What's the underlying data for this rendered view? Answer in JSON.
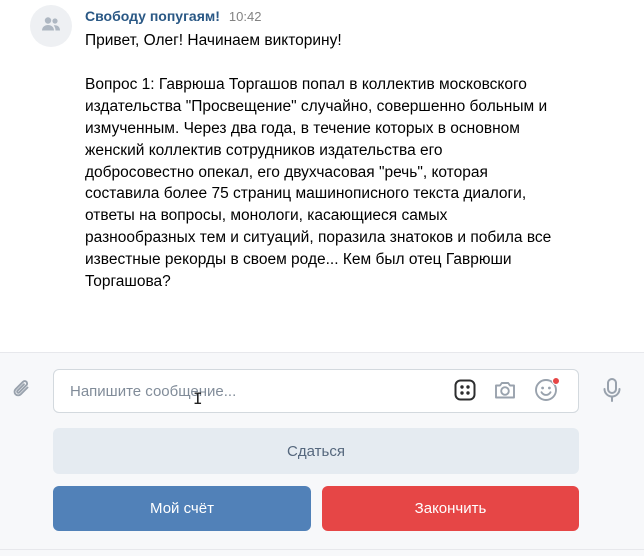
{
  "message": {
    "sender": "Свободу попугаям!",
    "time": "10:42",
    "greeting": "Привет, Олег! Начинаем викторину!",
    "question": "Вопрос 1: Гаврюша Торгашов попал в коллектив московского издательства \"Просвещение\" случайно, совершенно больным и измученным. Через два года, в течение которых в основном женский коллектив сотрудников издательства его добросовестно опекал, его двухчасовая \"речь\", которая составила более 75 страниц машинописного текста диалоги, ответы на вопросы, монологи, касающиеся самых разнообразных тем и ситуаций, поразила знатоков и побила все известные рекорды в своем роде... Кем был отец Гаврюши Торгашова?",
    "avatar_icon": "group-icon"
  },
  "composer": {
    "placeholder": "Напишите сообщение...",
    "value": "",
    "icons": [
      "paperclip-icon",
      "keyboard-icon",
      "camera-icon",
      "smile-icon",
      "microphone-icon"
    ],
    "notification_dot_color": "#e64646"
  },
  "buttons": {
    "give_up": "Сдаться",
    "my_score": "Мой счёт",
    "finish": "Закончить"
  },
  "colors": {
    "sender": "#2a5885",
    "give_up_bg": "#e5ebf1",
    "my_score_bg": "#5181b8",
    "finish_bg": "#e64646"
  }
}
